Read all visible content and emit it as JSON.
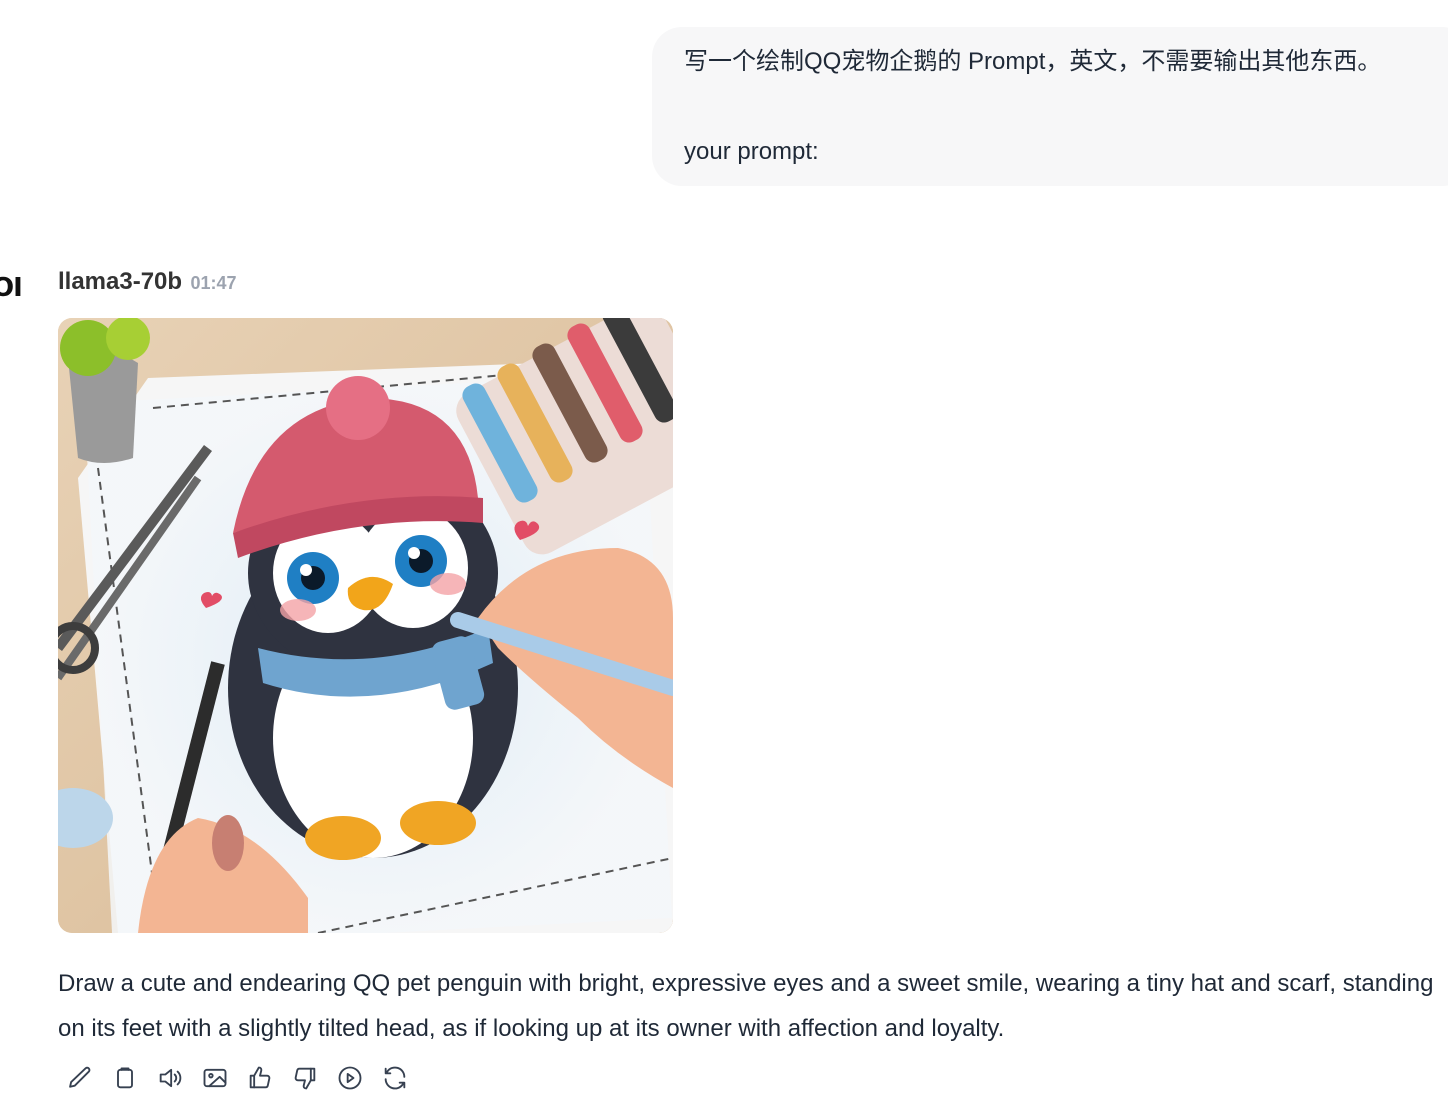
{
  "user_message": {
    "line1": "写一个绘制QQ宠物企鹅的 Prompt，英文，不需要输出其他东西。",
    "line2": "your prompt:"
  },
  "assistant": {
    "avatar_text": "OI",
    "model_name": "llama3-70b",
    "timestamp": "01:47",
    "image_icon": "generated-penguin-illustration",
    "reply_text": "Draw a cute and endearing QQ pet penguin with bright, expressive eyes and a sweet smile, wearing a tiny hat and scarf, standing on its feet with a slightly tilted head, as if looking up at its owner with affection and loyalty."
  },
  "action_icons": [
    "edit-icon",
    "copy-icon",
    "speaker-icon",
    "image-icon",
    "thumbs-up-icon",
    "thumbs-down-icon",
    "play-icon",
    "regenerate-icon"
  ],
  "colors": {
    "bubble_bg": "#f7f7f8",
    "text": "#1f2937",
    "muted": "#9ca3af"
  }
}
